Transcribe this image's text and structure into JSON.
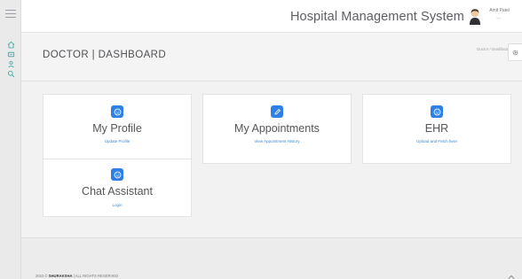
{
  "header": {
    "app_title": "Hospital Management System",
    "user_name": "Amit Patel",
    "user_menu_caret": "﹀"
  },
  "sidebar": {
    "items": [
      {
        "icon": "home-icon"
      },
      {
        "icon": "list-icon"
      },
      {
        "icon": "user-icon"
      },
      {
        "icon": "search-icon"
      }
    ]
  },
  "page": {
    "title": "DOCTOR | DASHBOARD",
    "breadcrumb": "Doctor  /  Dashboard"
  },
  "cards": [
    {
      "title": "My Profile",
      "link": "Update Profile",
      "icon": "smile-icon"
    },
    {
      "title": "My Appointments",
      "link": "View Appointment History",
      "icon": "pencil-icon"
    },
    {
      "title": "EHR",
      "link": "Upload and Fetch here",
      "icon": "smile-icon"
    },
    {
      "title": "Chat Assistant",
      "link": "Login",
      "icon": "smile-icon"
    }
  ],
  "footer": {
    "year_prefix": "2023 © ",
    "brand": "SHURAKSHA",
    "suffix": " | ALL RIGHTS RESERVED"
  },
  "colors": {
    "accent": "#2f7fe6",
    "sidebar_icon": "#3fb0a6",
    "link": "#3b8ad6"
  }
}
